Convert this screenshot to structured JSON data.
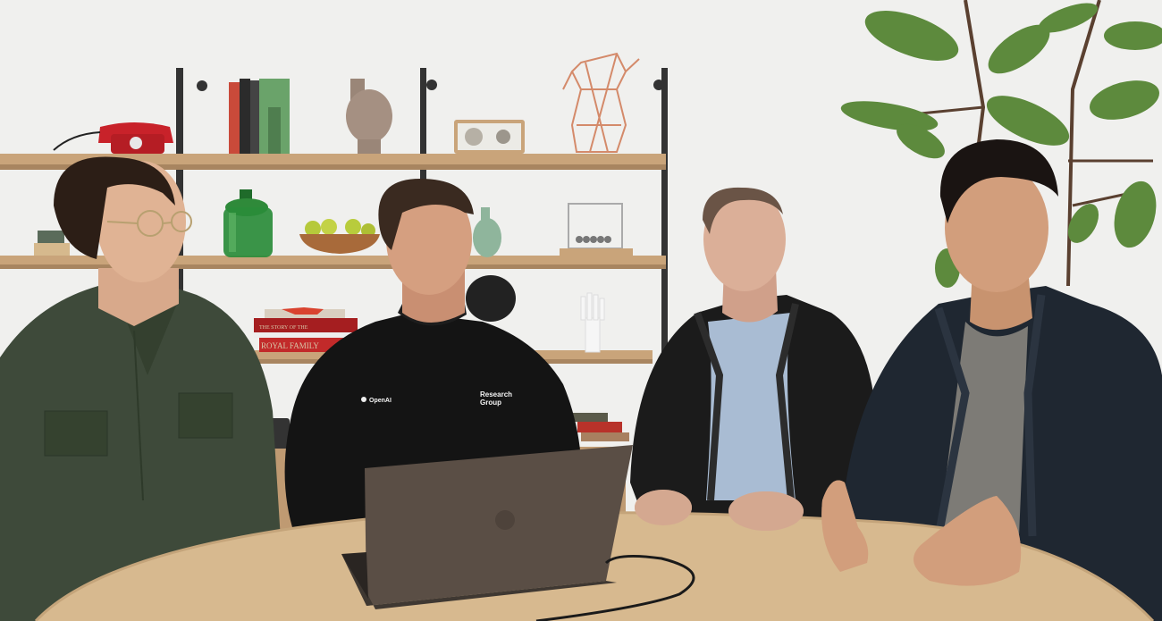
{
  "scene": {
    "people": [
      {
        "id": "person-1",
        "shirt": "green button-up shirt",
        "shirt_color": "#3e4a3a"
      },
      {
        "id": "person-2",
        "shirt": "black sweatshirt",
        "shirt_color": "#141414"
      },
      {
        "id": "person-3",
        "shirt": "black leather jacket",
        "shirt_color": "#1b1b1b"
      },
      {
        "id": "person-4",
        "shirt": "dark navy jacket",
        "shirt_color": "#1f2731"
      }
    ],
    "sweatshirt_logo": "OpenAI",
    "sweatshirt_text_line1": "Research",
    "sweatshirt_text_line2": "Group",
    "book_spine_1": "THE STORY OF THE",
    "book_spine_2": "ROYAL FAMILY",
    "colors": {
      "wall": "#ececea",
      "shelf_wood": "#c9a47a",
      "table_wood": "#d7b98f",
      "laptop": "#5a4e45",
      "plant_leaf": "#5d8a3d"
    }
  }
}
